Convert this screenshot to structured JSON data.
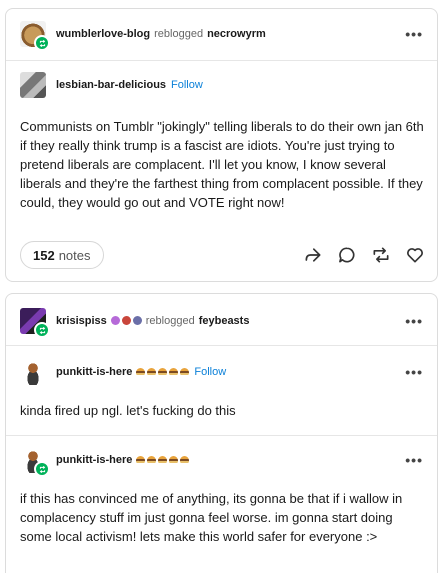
{
  "card1": {
    "reblogger": "wumblerlove-blog",
    "reblogged_text": "reblogged",
    "reblogged_from": "necrowyrm",
    "poster": "lesbian-bar-delicious",
    "follow_label": "Follow",
    "body": "Communists on Tumblr \"jokingly\" telling liberals to do their own jan 6th if they really think trump is a fascist are idiots. You're just trying to pretend liberals are complacent. I'll let you know, I know several liberals and they're the farthest thing from complacent possible. If they could, they would go out and VOTE right now!",
    "notes_count": "152",
    "notes_label": "notes",
    "more_label": "•••"
  },
  "card2": {
    "reblogger": "krisispiss",
    "reblogged_text": "reblogged",
    "reblogged_from": "feybeasts",
    "more_label": "•••",
    "post1": {
      "author": "punkitt-is-here",
      "follow_label": "Follow",
      "body": "kinda fired up ngl. let's fucking do this"
    },
    "post2": {
      "author": "punkitt-is-here",
      "body": "if this has convinced me of anything, its gonna be that if i wallow in complacency stuff im just gonna feel worse. im gonna start doing some local activism! lets make this world safer for everyone :>"
    }
  },
  "icons": [
    "share-icon",
    "reply-icon",
    "reblog-icon",
    "like-icon",
    "more-icon",
    "burger-emoji-icon",
    "reblog-badge-icon"
  ],
  "colors": {
    "follow": "#0b80d8",
    "badge": "#00b25a",
    "border": "#dcdcdc"
  }
}
